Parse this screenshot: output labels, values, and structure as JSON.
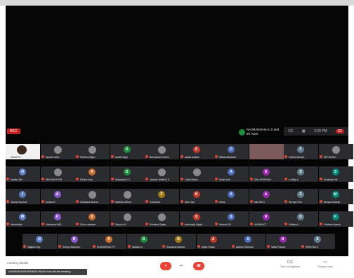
{
  "recording_badge": "REC",
  "notice_text": "NAJMANISHA K.S and 60 more",
  "top_controls": {
    "time": "3:20 PM",
    "people_count": "62"
  },
  "colors": {
    "bubble_palette": [
      "#5b7cc1",
      "#8e5bd1",
      "#c96c2c",
      "#1e8e3e",
      "#a37a16",
      "#c0392b",
      "#4a6dbd",
      "#9c27b0",
      "#607d8b",
      "#00897b"
    ]
  },
  "tiles": [
    [
      {
        "name": "Vimal PC",
        "self": true
      },
      {
        "name": "Janaki Hebb",
        "letter": "",
        "photo": true
      },
      {
        "name": "Shobha Bijoo",
        "letter": "",
        "photo": true
      },
      {
        "name": "swathi vijay",
        "letter": "S"
      },
      {
        "name": "Bennasam Nanni",
        "letter": "",
        "photo": true
      },
      {
        "name": "sujata solkari",
        "letter": "S"
      },
      {
        "name": "Ditsa Mahanbe",
        "letter": "D"
      },
      {
        "name": "",
        "video": true
      },
      {
        "name": "Fatima Ansari",
        "letter": "F"
      },
      {
        "name": "SRI GURU",
        "letter": "",
        "photo": true
      }
    ],
    [
      {
        "name": "Nadia Gibi",
        "letter": "N"
      },
      {
        "name": "ANUSHKA PM",
        "letter": "",
        "photo": true
      },
      {
        "name": "Rekha kaur",
        "letter": "R"
      },
      {
        "name": "Shalakaa K V",
        "letter": "S"
      },
      {
        "name": "Jahana Malik K S",
        "letter": "",
        "photo": true
      },
      {
        "name": "Fadis Ninan",
        "letter": "",
        "photo": true
      },
      {
        "name": "Anabi Anil",
        "letter": "A"
      },
      {
        "name": "SAN KRISHNA",
        "letter": "S"
      },
      {
        "name": "s raMy a",
        "letter": "S"
      },
      {
        "name": "Sulaiman Mr",
        "letter": "S"
      }
    ],
    [
      {
        "name": "Jaunty Donnal",
        "letter": "J"
      },
      {
        "name": "Amrita G",
        "letter": "A"
      },
      {
        "name": "Shobana Anirud",
        "letter": "",
        "photo": true
      },
      {
        "name": "Manisha Mech",
        "letter": "",
        "photo": true
      },
      {
        "name": "Farseena",
        "letter": "F"
      },
      {
        "name": "Nihe riya",
        "letter": "N"
      },
      {
        "name": "shiha",
        "letter": "S"
      },
      {
        "name": "Alla Siti S",
        "letter": "A"
      },
      {
        "name": "Shreya Shri",
        "letter": "S"
      },
      {
        "name": "Mohana Manjh",
        "letter": "M"
      }
    ],
    [
      {
        "name": "Mushthika",
        "letter": "M"
      },
      {
        "name": "Fazreena MIO",
        "letter": "F"
      },
      {
        "name": "Shon ukadam",
        "letter": "S"
      },
      {
        "name": "Sayoor M",
        "letter": "",
        "photo": true
      },
      {
        "name": "Renisha Sajan",
        "letter": "",
        "photo": true
      },
      {
        "name": "shahsady Sajad",
        "letter": "S"
      },
      {
        "name": "Seema Sk",
        "letter": "S"
      },
      {
        "name": "HASNA KT",
        "letter": "H"
      },
      {
        "name": "Dhidea K",
        "letter": "D"
      },
      {
        "name": "Fathima Nasrin",
        "letter": "F"
      }
    ],
    [
      {
        "name": "Najana Raj",
        "letter": "N"
      },
      {
        "name": "Remya Baichan",
        "letter": "R"
      },
      {
        "name": "SHAREENA P.V",
        "letter": "S"
      },
      {
        "name": "Sahala m",
        "letter": "S"
      },
      {
        "name": "Ranaana Rasna",
        "letter": "R"
      },
      {
        "name": "Aydin Haaki",
        "letter": "A"
      },
      {
        "name": "Aaima Rahman",
        "letter": "A"
      },
      {
        "name": "Nafla Faraza",
        "letter": "N"
      },
      {
        "name": "SREYNA S",
        "letter": "S"
      }
    ]
  ],
  "meeting_info": "meeting details",
  "toast": "NAVEENANISHA/MMAV NNOId has left the meeting",
  "controls": {
    "mic": "mic-off",
    "more": "•••",
    "end": "end-call"
  },
  "right_controls": [
    {
      "icon": "CC",
      "label": "Turn on captions"
    },
    {
      "icon": "▭",
      "label": "Present now"
    }
  ]
}
